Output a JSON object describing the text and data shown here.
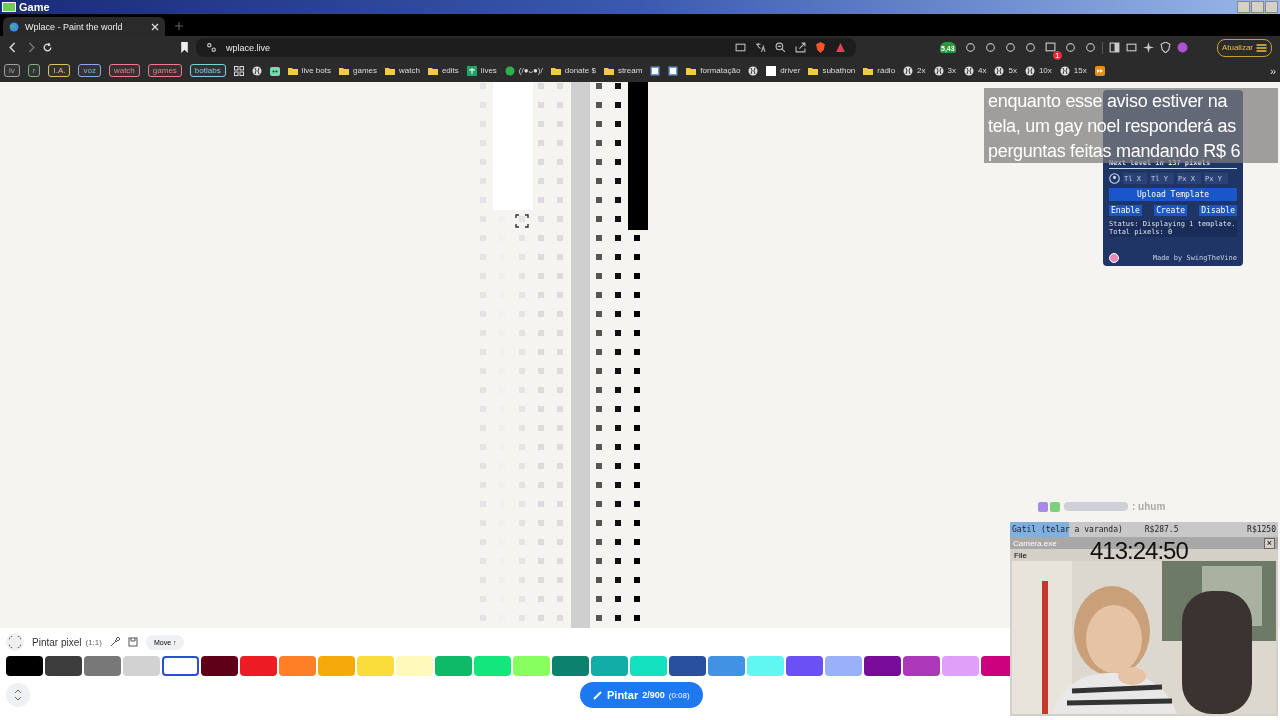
{
  "os_window": {
    "title": "Game"
  },
  "browser_tab": {
    "title": "Wplace - Paint the world"
  },
  "address_bar": {
    "url": "wplace.live"
  },
  "extensions": [
    {
      "kind": "counter",
      "badge": "5,43"
    },
    {
      "kind": "plain"
    },
    {
      "kind": "plain"
    },
    {
      "kind": "plain"
    },
    {
      "kind": "plain"
    },
    {
      "kind": "notify",
      "badge": "1"
    },
    {
      "kind": "plain"
    },
    {
      "kind": "plain"
    }
  ],
  "update_button": "Atualizar",
  "bookmarks": [
    {
      "kind": "chip",
      "label": "lv",
      "color": "#9aa0a6"
    },
    {
      "kind": "chip",
      "label": "r",
      "color": "#7fb08a"
    },
    {
      "kind": "chip",
      "label": "I.A.",
      "color": "#e0c060"
    },
    {
      "kind": "chip",
      "label": "voz",
      "color": "#8aa8e8"
    },
    {
      "kind": "chip",
      "label": "watch",
      "color": "#f07a8a"
    },
    {
      "kind": "chip",
      "label": "games",
      "color": "#f07a8a"
    },
    {
      "kind": "chip",
      "label": "botlabs",
      "color": "#7fd0e0"
    },
    {
      "kind": "apps"
    },
    {
      "kind": "globe"
    },
    {
      "kind": "robot"
    },
    {
      "kind": "folder",
      "label": "live bots"
    },
    {
      "kind": "folder",
      "label": "games"
    },
    {
      "kind": "folder",
      "label": "watch"
    },
    {
      "kind": "folder",
      "label": "edits"
    },
    {
      "kind": "sheet",
      "label": "lives"
    },
    {
      "kind": "leaf",
      "label": "(/●ᴗ●)/"
    },
    {
      "kind": "folder",
      "label": "donate $"
    },
    {
      "kind": "folder",
      "label": "stream"
    },
    {
      "kind": "page"
    },
    {
      "kind": "page"
    },
    {
      "kind": "folder",
      "label": "formatação"
    },
    {
      "kind": "globe"
    },
    {
      "kind": "blank",
      "label": "driver"
    },
    {
      "kind": "folder",
      "label": "subathon"
    },
    {
      "kind": "folder",
      "label": "rádio"
    },
    {
      "kind": "globe",
      "label": "2x"
    },
    {
      "kind": "globe",
      "label": "3x"
    },
    {
      "kind": "globe",
      "label": "4x"
    },
    {
      "kind": "globe",
      "label": "5x"
    },
    {
      "kind": "globe",
      "label": "10x"
    },
    {
      "kind": "globe",
      "label": "15x"
    },
    {
      "kind": "forward"
    }
  ],
  "bookmarks_more": "»",
  "blue_marble": {
    "next_level": "Next level in 137 pixels",
    "coord_placeholders": [
      "Tl X",
      "Tl Y",
      "Px X",
      "Px Y"
    ],
    "upload": "Upload Template",
    "actions": [
      "Enable",
      "Create",
      "Disable"
    ],
    "status": "Status: Displaying 1 template.",
    "status_cut": "Total pixels: 0",
    "credit": "Made by SwingTheVine"
  },
  "stream_notice": "enquanto esse aviso estiver na\ntela, um gay noel responderá as\nperguntas feitas mandando R$ 6",
  "chat": {
    "message": ": uhum"
  },
  "goal": {
    "label": "Gatil (telar a varanda)",
    "current": "R$287.5",
    "target": "R$1250",
    "level": 0.22
  },
  "timer": "413:24:50",
  "camera_window": {
    "title": "Camera.exe",
    "menu": "File",
    "close": "×"
  },
  "tool_bar": {
    "mode": "Pintar pixel",
    "scale": "(1:1)",
    "move": "Move ↑"
  },
  "palette": [
    {
      "color": "#000000",
      "selected": false
    },
    {
      "color": "#3c3c3c",
      "selected": false
    },
    {
      "color": "#787878",
      "selected": false
    },
    {
      "color": "#d2d2d2",
      "selected": false
    },
    {
      "color": "#ffffff",
      "selected": true
    },
    {
      "color": "#600018",
      "selected": false
    },
    {
      "color": "#ed1c24",
      "selected": false
    },
    {
      "color": "#ff7f27",
      "selected": false
    },
    {
      "color": "#f6aa09",
      "selected": false
    },
    {
      "color": "#f9dd3b",
      "selected": false
    },
    {
      "color": "#fffabc",
      "selected": false
    },
    {
      "color": "#0eb968",
      "selected": false
    },
    {
      "color": "#13e67b",
      "selected": false
    },
    {
      "color": "#87ff5e",
      "selected": false
    },
    {
      "color": "#0c816e",
      "selected": false
    },
    {
      "color": "#10aea6",
      "selected": false
    },
    {
      "color": "#13e1be",
      "selected": false
    },
    {
      "color": "#28509e",
      "selected": false
    },
    {
      "color": "#4093e4",
      "selected": false
    },
    {
      "color": "#60f7f2",
      "selected": false
    },
    {
      "color": "#6b50f6",
      "selected": false
    },
    {
      "color": "#99b1fb",
      "selected": false
    },
    {
      "color": "#780c99",
      "selected": false
    },
    {
      "color": "#aa38b9",
      "selected": false
    },
    {
      "color": "#e09ff9",
      "selected": false
    },
    {
      "color": "#cb007a",
      "selected": false
    }
  ],
  "paint_button": {
    "label": "Pintar",
    "count": "2/900",
    "timer": "(0:08)"
  }
}
